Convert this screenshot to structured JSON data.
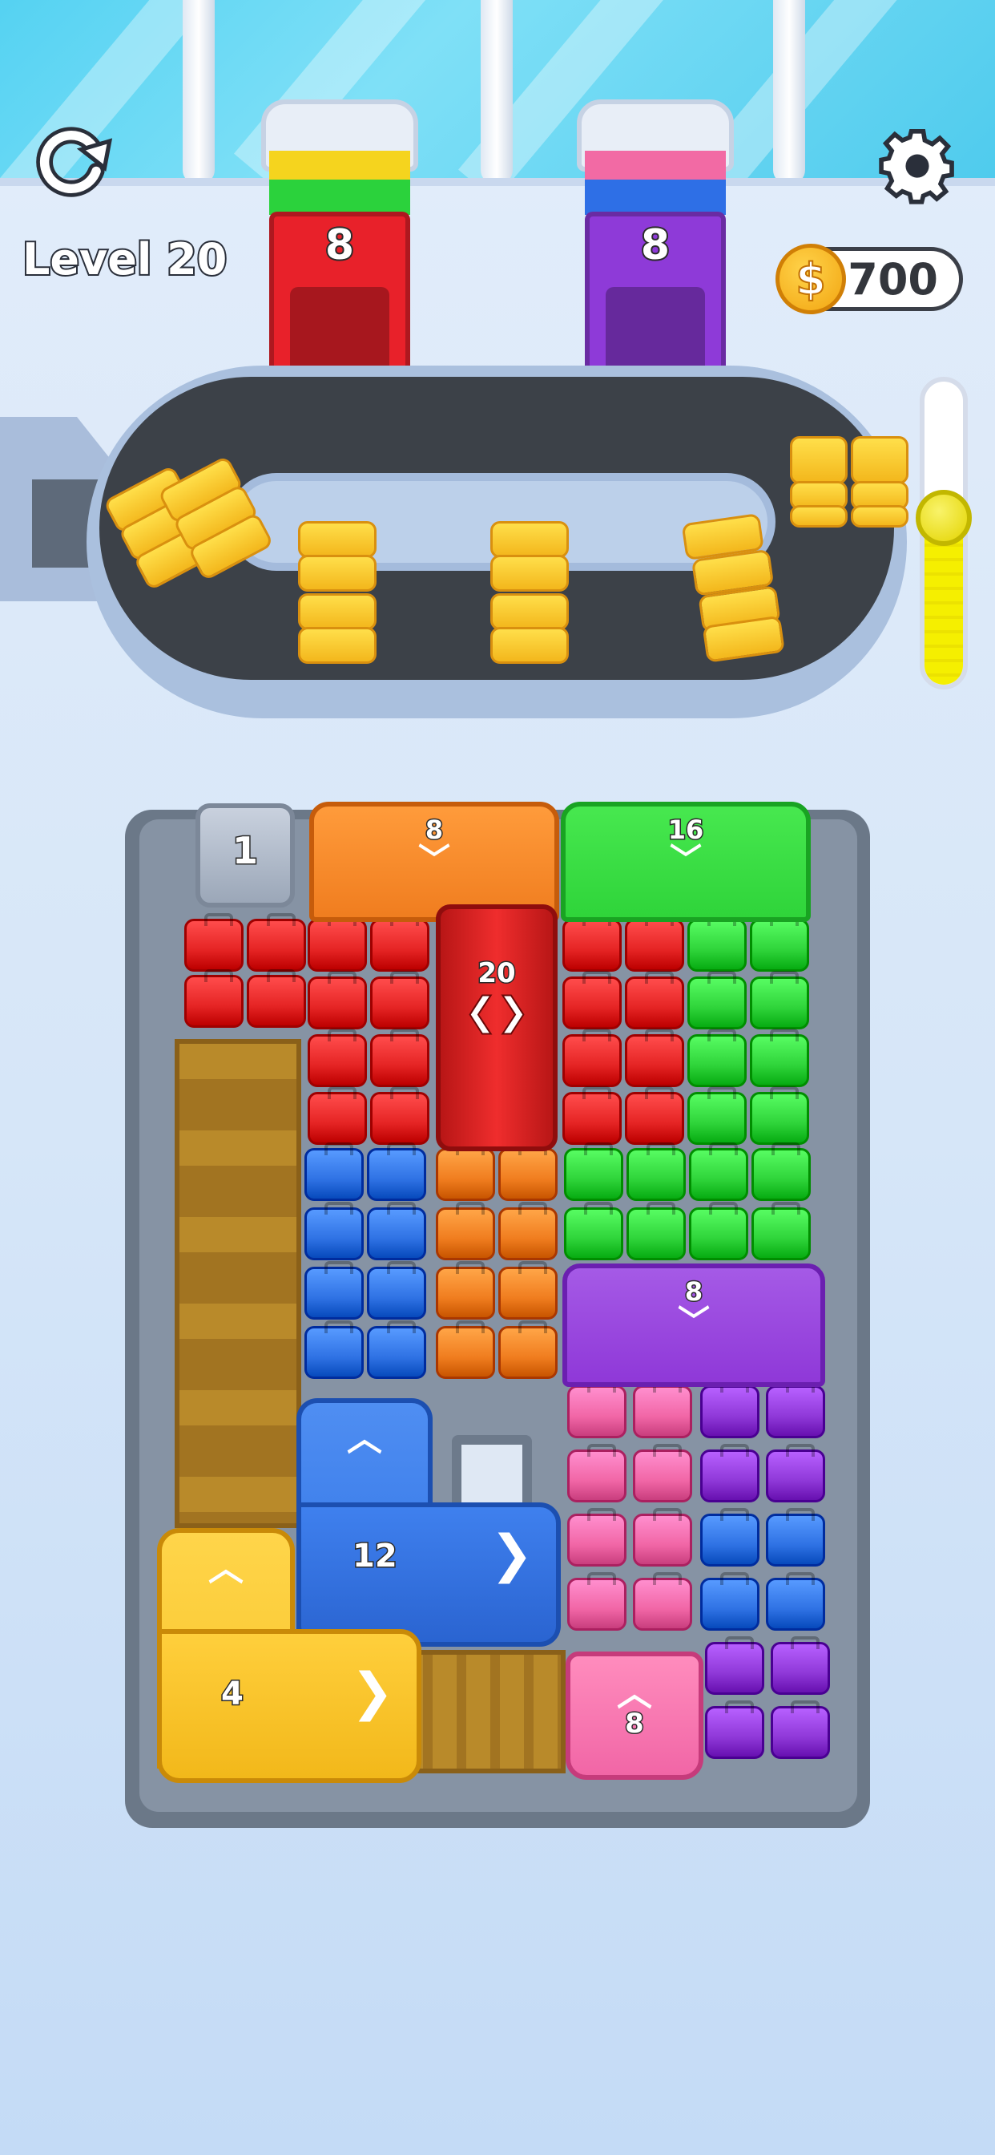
{
  "hud": {
    "level_label": "Level 20",
    "coins": "700",
    "coin_symbol": "$",
    "restart_icon": "restart-icon",
    "settings_icon": "gear-icon",
    "progress_fraction": 0.55
  },
  "dispensers": [
    {
      "count": "8",
      "color": "#e8212a",
      "bands": [
        "#f5d41e",
        "#2bd23c"
      ]
    },
    {
      "count": "8",
      "color": "#8e3ad8",
      "bands": [
        "#f26aa4",
        "#2e6fe6"
      ]
    }
  ],
  "board": {
    "gray_block": {
      "count": "1"
    },
    "orange_top": {
      "count": "8"
    },
    "green_top": {
      "count": "16"
    },
    "red_center": {
      "count": "20"
    },
    "purple_mid": {
      "count": "8"
    },
    "blue_l": {
      "count": "12"
    },
    "yellow_l": {
      "count": "4"
    },
    "pink_block": {
      "count": "8"
    }
  },
  "colors": {
    "red": "#e52424",
    "orange": "#f07d1f",
    "green": "#2fd43a",
    "blue": "#2f72e4",
    "purple": "#8f38d8",
    "pink": "#f166a6",
    "yellow": "#f7c428"
  }
}
